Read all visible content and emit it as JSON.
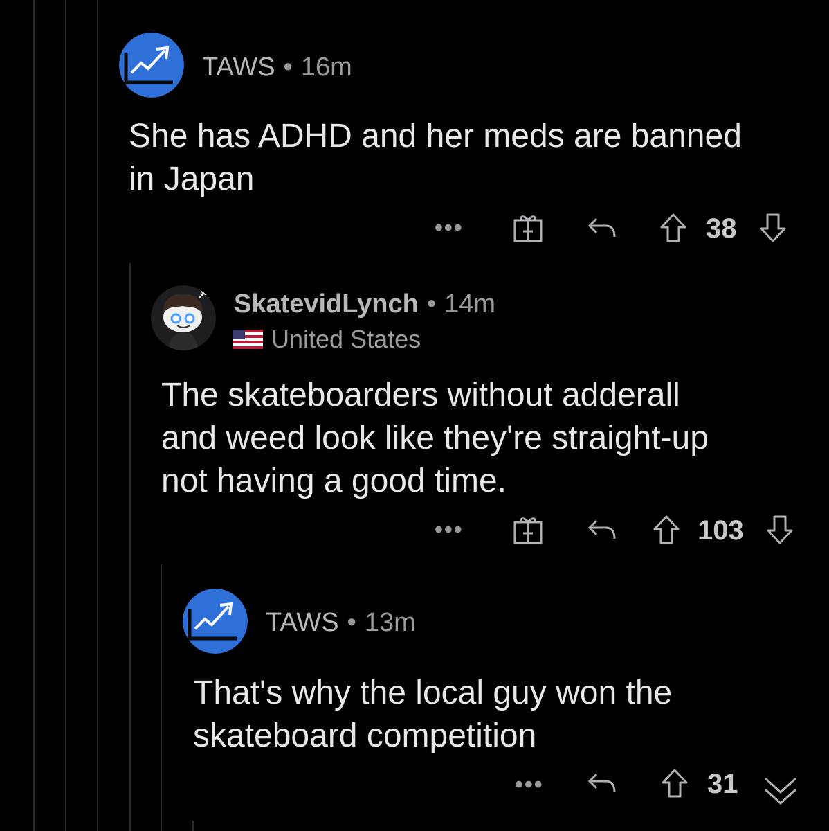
{
  "theme": {
    "background": "#000000",
    "avatar_blue": "#2f6fd8",
    "text": "#e8e8ea",
    "muted": "#9a9a9e"
  },
  "comments": [
    {
      "username": "TAWS",
      "separator": "•",
      "time": "16m",
      "body_lines": [
        "She has ADHD and her meds are banned",
        "in Japan"
      ],
      "score": "38",
      "more": "•••",
      "icons": [
        "more-options-icon",
        "award-gift-icon",
        "reply-icon",
        "upvote-icon",
        "downvote-icon"
      ]
    },
    {
      "username": "SkatevidLynch",
      "separator": "•",
      "time": "14m",
      "flair": "United States",
      "body_lines": [
        "The skateboarders without adderall",
        "and weed look like they're straight-up",
        "not having a good time."
      ],
      "score": "103",
      "more": "•••",
      "icons": [
        "more-options-icon",
        "award-gift-icon",
        "reply-icon",
        "upvote-icon",
        "downvote-icon"
      ]
    },
    {
      "username": "TAWS",
      "separator": "•",
      "time": "13m",
      "body_lines": [
        "That's why the local guy won the",
        "skateboard competition"
      ],
      "score": "31",
      "more": "•••",
      "icons": [
        "more-options-icon",
        "reply-icon",
        "upvote-icon",
        "collapse-chevron-icon"
      ]
    }
  ]
}
